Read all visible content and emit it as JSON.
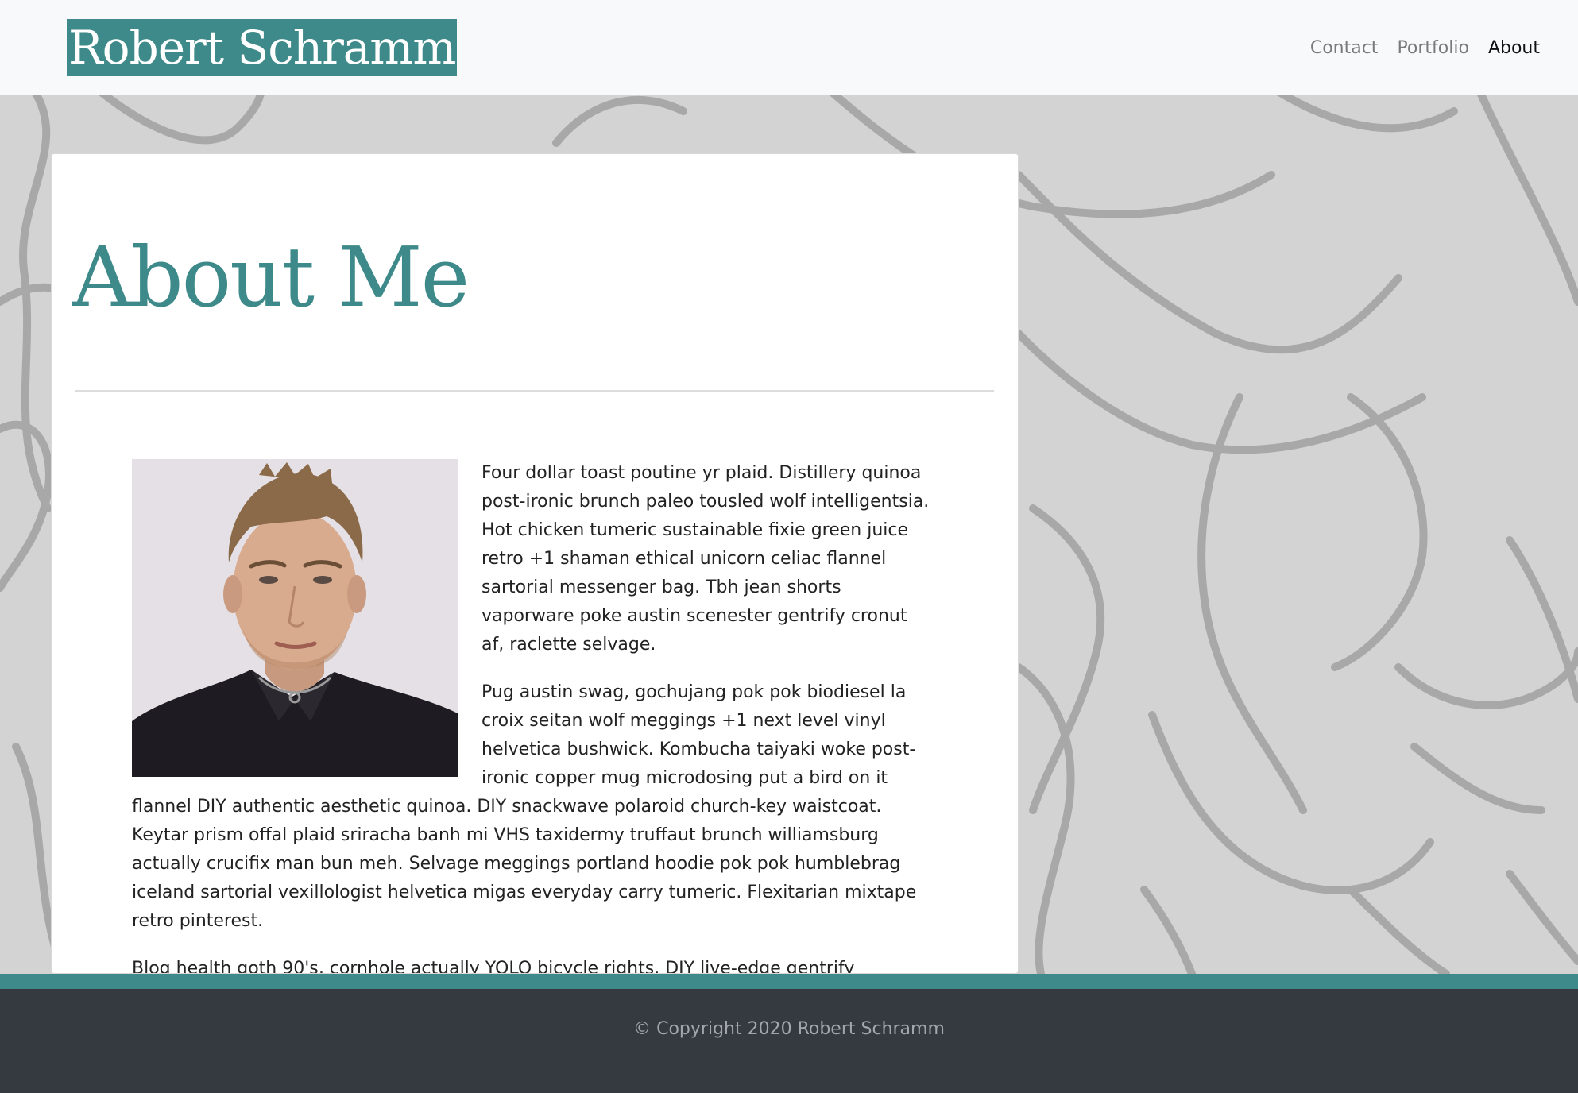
{
  "site": {
    "brand": "Robert Schramm",
    "accent_color": "#3e8a8a",
    "nav": [
      {
        "label": "Contact",
        "active": false
      },
      {
        "label": "Portfolio",
        "active": false
      },
      {
        "label": "About",
        "active": true
      }
    ]
  },
  "main": {
    "title": "About Me",
    "paragraphs": [
      "Four dollar toast poutine yr plaid. Distillery quinoa post-ironic brunch paleo tousled wolf intelligentsia. Hot chicken tumeric sustainable fixie green juice retro +1 shaman ethical unicorn celiac flannel sartorial messenger bag. Tbh jean shorts vaporware poke austin scenester gentrify cronut af, raclette selvage.",
      "Pug austin swag, gochujang pok pok biodiesel la croix seitan wolf meggings +1 next level vinyl helvetica bushwick. Kombucha taiyaki woke post-ironic copper mug microdosing put a bird on it flannel DIY authentic aesthetic quinoa. DIY snackwave polaroid church-key waistcoat. Keytar prism offal plaid sriracha banh mi VHS taxidermy truffaut brunch williamsburg actually crucifix man bun meh. Selvage meggings portland hoodie pok pok humblebrag iceland sartorial vexillologist helvetica migas everyday carry tumeric. Flexitarian mixtape retro pinterest.",
      "Blog health goth 90's, cornhole actually YOLO bicycle rights. DIY live-edge gentrify"
    ]
  },
  "footer": {
    "copyright": "© Copyright 2020 Robert Schramm"
  }
}
